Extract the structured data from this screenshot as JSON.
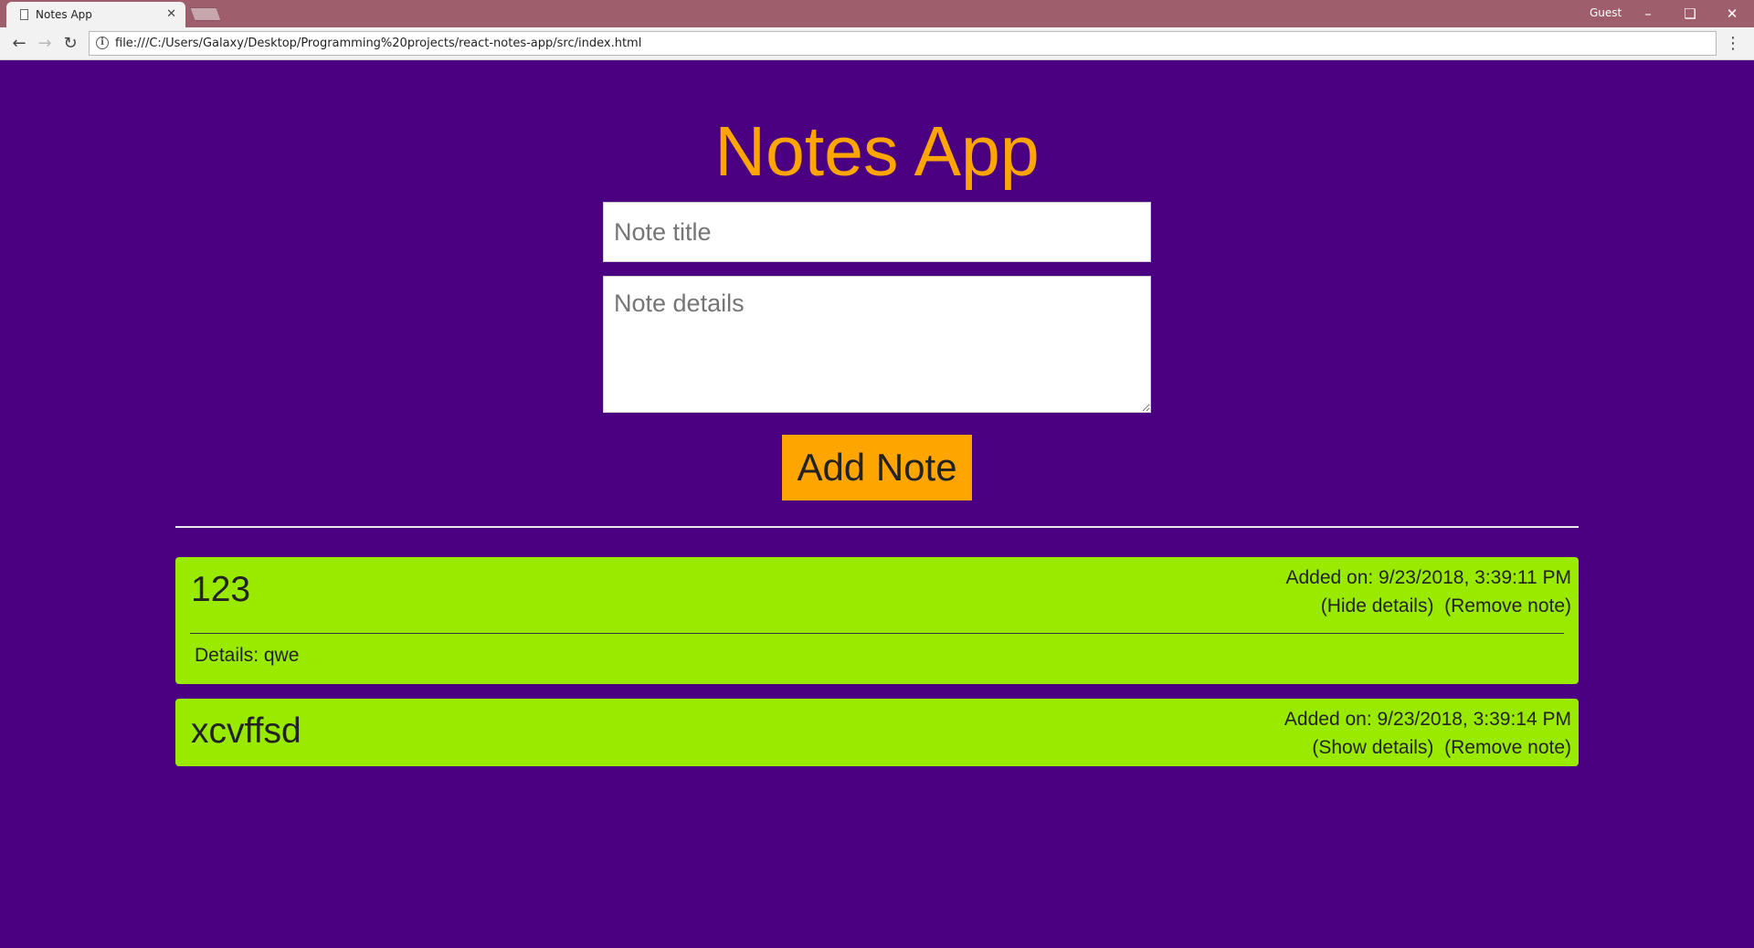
{
  "browser": {
    "tab_title": "Notes App",
    "tab_close": "✕",
    "user_label": "Guest",
    "url": "file:///C:/Users/Galaxy/Desktop/Programming%20projects/react-notes-app/src/index.html",
    "icons": {
      "back": "arrow-left",
      "forward": "arrow-right",
      "reload": "reload",
      "info": "info",
      "menu": "vertical-ellipsis",
      "minimize": "minimize",
      "restore": "restore",
      "close": "close"
    }
  },
  "app": {
    "title": "Notes App",
    "title_placeholder": "Note title",
    "details_placeholder": "Note details",
    "add_button": "Add Note",
    "colors": {
      "background": "#4b0082",
      "accent": "#ffa500",
      "note_background": "#9aea00"
    }
  },
  "notes": [
    {
      "title": "123",
      "added_on": "Added on: 9/23/2018, 3:39:11 PM",
      "toggle_label": "(Hide details)",
      "remove_label": "(Remove note)",
      "details": "Details: qwe"
    },
    {
      "title": "xcvffsd",
      "added_on": "Added on: 9/23/2018, 3:39:14 PM",
      "toggle_label": "(Show details)",
      "remove_label": "(Remove note)"
    }
  ]
}
